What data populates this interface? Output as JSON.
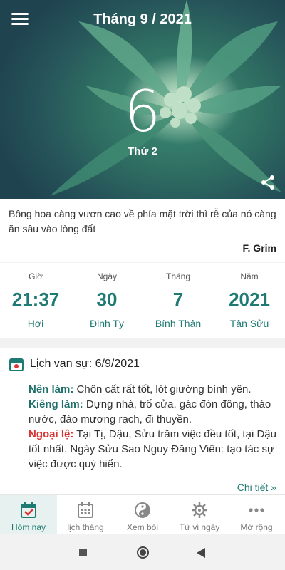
{
  "header": {
    "title": "Tháng 9 / 2021",
    "day": "6",
    "weekday": "Thứ 2"
  },
  "quote": {
    "text": "Bông hoa càng vươn cao về phía mặt trời thì rễ của nó càng ăn sâu vào lòng đất",
    "author": "F. Grim"
  },
  "lunar": {
    "hour": {
      "label": "Giờ",
      "value": "21:37",
      "sub": "Hợi"
    },
    "day": {
      "label": "Ngày",
      "value": "30",
      "sub": "Đinh Tỵ"
    },
    "month": {
      "label": "Tháng",
      "value": "7",
      "sub": "Bính Thân"
    },
    "year": {
      "label": "Năm",
      "value": "2021",
      "sub": "Tân Sửu"
    }
  },
  "events": {
    "title": "Lịch vạn sự: 6/9/2021",
    "good_label": "Nên làm:",
    "good_text": " Chôn cất rất tốt, lót giường bình yên.",
    "bad_label": "Kiêng làm:",
    "bad_text": " Dựng nhà, trổ cửa, gác đòn đông, tháo nước, đào mương rạch, đi thuyền.",
    "exception_label": "Ngoại lệ:",
    "exception_text": " Tại Tị, Dậu, Sửu trăm việc đều tốt, tại Dậu tốt nhất. Ngày Sửu Sao Nguy Đăng Viên: tạo tác sự việc được quý hiển.",
    "more": "Chi tiết »"
  },
  "tabs": [
    {
      "label": "Hôm nay",
      "icon": "calendar-check-icon"
    },
    {
      "label": "lịch tháng",
      "icon": "calendar-grid-icon"
    },
    {
      "label": "Xem bói",
      "icon": "yin-yang-icon"
    },
    {
      "label": "Tử vi ngày",
      "icon": "dharma-wheel-icon"
    },
    {
      "label": "Mở rộng",
      "icon": "more-dots-icon"
    }
  ],
  "colors": {
    "accent": "#1f7a73",
    "exception": "#d93434"
  }
}
